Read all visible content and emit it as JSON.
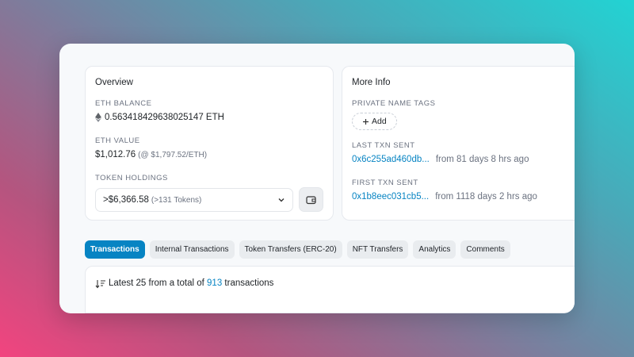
{
  "overview": {
    "title": "Overview",
    "eth_balance_label": "ETH BALANCE",
    "eth_balance_value": "0.563418429638025147 ETH",
    "eth_value_label": "ETH VALUE",
    "eth_value_amount": "$1,012.76",
    "eth_value_rate": "(@ $1,797.52/ETH)",
    "token_holdings_label": "TOKEN HOLDINGS",
    "token_holdings_value": ">$6,366.58",
    "token_holdings_count": "(>131 Tokens)"
  },
  "more_info": {
    "title": "More Info",
    "private_tags_label": "PRIVATE NAME TAGS",
    "add_label": "Add",
    "last_txn_label": "LAST TXN SENT",
    "last_txn_hash": "0x6c255ad460db...",
    "last_txn_from": "from 81 days 8 hrs ago",
    "first_txn_label": "FIRST TXN SENT",
    "first_txn_hash": "0x1b8eec031cb5...",
    "first_txn_from": "from 1118 days 2 hrs ago"
  },
  "tabs": [
    {
      "label": "Transactions",
      "active": true
    },
    {
      "label": "Internal Transactions",
      "active": false
    },
    {
      "label": "Token Transfers (ERC-20)",
      "active": false
    },
    {
      "label": "NFT Transfers",
      "active": false
    },
    {
      "label": "Analytics",
      "active": false
    },
    {
      "label": "Comments",
      "active": false
    }
  ],
  "transactions_summary": {
    "prefix": "Latest 25 from a total of",
    "total": "913",
    "suffix": "transactions"
  },
  "colors": {
    "accent": "#0784c3",
    "tab_bg": "#e9ecef"
  },
  "icons": {
    "eth": "ethereum-icon",
    "dropdown": "chevron-down-icon",
    "wallet": "wallet-icon",
    "add": "plus-icon",
    "sort": "sort-descending-icon"
  }
}
